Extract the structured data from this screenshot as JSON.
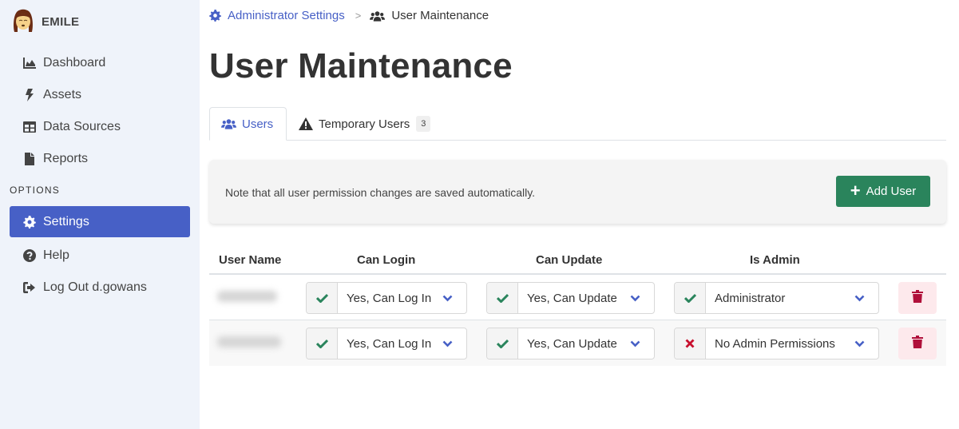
{
  "sidebar": {
    "brand_name": "EMILE",
    "nav_items": [
      {
        "label": "Dashboard",
        "icon": "chart-area-icon"
      },
      {
        "label": "Assets",
        "icon": "bolt-icon"
      },
      {
        "label": "Data Sources",
        "icon": "table-icon"
      },
      {
        "label": "Reports",
        "icon": "file-icon"
      }
    ],
    "section_label": "OPTIONS",
    "option_items": [
      {
        "label": "Settings",
        "icon": "gear-icon",
        "active": true
      },
      {
        "label": "Help",
        "icon": "question-circle-icon"
      },
      {
        "label": "Log Out d.gowans",
        "icon": "sign-out-icon"
      }
    ]
  },
  "breadcrumb": {
    "parent": "Administrator Settings",
    "separator": ">",
    "current": "User Maintenance"
  },
  "page_title": "User Maintenance",
  "tabs": [
    {
      "label": "Users",
      "active": true
    },
    {
      "label": "Temporary Users",
      "badge": "3"
    }
  ],
  "notice": {
    "text": "Note that all user permission changes are saved automatically.",
    "add_button": "Add User"
  },
  "table": {
    "columns": [
      "User Name",
      "Can Login",
      "Can Update",
      "Is Admin"
    ],
    "rows": [
      {
        "user_name": "[blurred]",
        "can_login": "Yes, Can Log In",
        "can_login_ok": true,
        "can_update": "Yes, Can Update",
        "can_update_ok": true,
        "is_admin": "Administrator",
        "is_admin_ok": true
      },
      {
        "user_name": "[blurred]",
        "can_login": "Yes, Can Log In",
        "can_login_ok": true,
        "can_update": "Yes, Can Update",
        "can_update_ok": true,
        "is_admin": "No Admin Permissions",
        "is_admin_ok": false
      }
    ]
  },
  "colors": {
    "accent": "#4760c6",
    "success": "#2a845c",
    "danger": "#b0103a",
    "sidebar_bg": "#eff3fa"
  }
}
